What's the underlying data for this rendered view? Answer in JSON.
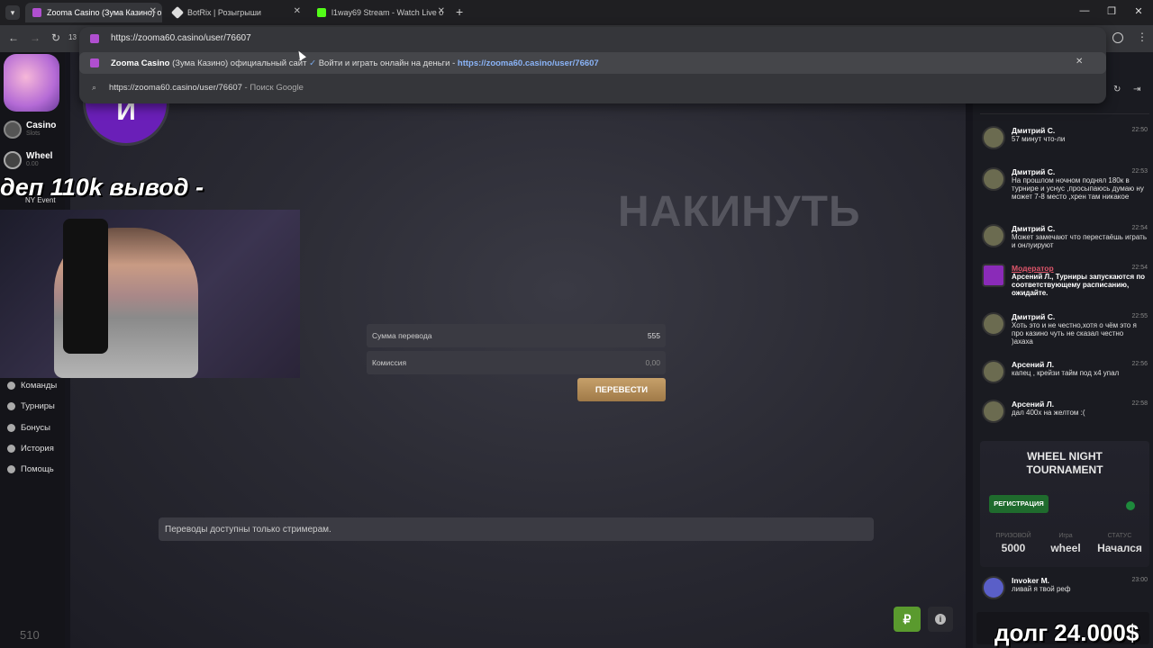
{
  "browser": {
    "tabs": [
      {
        "label": "Zooma Casino (Зума Казино) о",
        "active": true
      },
      {
        "label": "BotRix | Розыгрыши",
        "active": false
      },
      {
        "label": "l1way69 Stream - Watch Live o",
        "active": false
      }
    ],
    "reload_count": "13",
    "url": "https://zooma60.casino/user/76607",
    "suggestions": [
      {
        "site": "Zooma Casino",
        "desc": " (Зума Казино) официальный сайт",
        "rest": " Войти и играть онлайн на деньги - ",
        "url": "https://zooma60.casino/user/76607"
      },
      {
        "site": "",
        "desc": "https://zooma60.casino/user/76607",
        "rest": " - Поиск Google",
        "url": ""
      }
    ]
  },
  "sidebar": {
    "items_top": [
      {
        "label": "Casino",
        "sub": "Slots"
      },
      {
        "label": "Wheel",
        "sub": "0.00"
      }
    ],
    "ny_event": "NY Event",
    "menu": [
      "Команды",
      "Турниры",
      "Бонусы",
      "История",
      "Помощь"
    ],
    "counter": "510"
  },
  "main": {
    "avatar_letter": "И",
    "heading": "НАКИНУТЬ",
    "amount_label": "Сумма перевода",
    "amount_value": "555",
    "fee_label": "Комиссия",
    "fee_value": "0,00",
    "submit_label": "ПЕРЕВЕСТИ",
    "notice": "Переводы доступны только стримерам."
  },
  "chat": {
    "messages": [
      {
        "name": "Дмитрий С.",
        "time": "22:50",
        "text": "57 минут что-ли",
        "mod": false
      },
      {
        "name": "Дмитрий С.",
        "time": "22:53",
        "text": "На прошлом ночном поднял 180к в турнире и уснус ,просыпаюсь думаю ну может 7-8 место ,хрен там никакое",
        "mod": false
      },
      {
        "name": "Дмитрий С.",
        "time": "22:54",
        "text": "Может замечают что перестаёшь играть и онлуируют",
        "mod": false
      },
      {
        "name": "Модератор",
        "time": "22:54",
        "text": "Арсений Л., Турниры запускаются по соответствующему расписанию, ожидайте.",
        "mod": true
      },
      {
        "name": "Дмитрий С.",
        "time": "22:55",
        "text": "Хоть это и не честно,хотя о чём это я про казино чуть не сказал честно )ахаха",
        "mod": false
      },
      {
        "name": "Арсений Л.",
        "time": "22:56",
        "text": "капец , крейзи тайм под х4 упал",
        "mod": false
      },
      {
        "name": "Арсений Л.",
        "time": "22:58",
        "text": "дал 400х на желтом :(",
        "mod": false
      }
    ],
    "tournament": {
      "title": "WHEEL NIGHT TOURNAMENT",
      "register": "РЕГИСТРАЦИЯ",
      "prize_label": "ПРИЗОВОЙ",
      "prize": "5000",
      "game_label": "Игра",
      "game": "wheel",
      "status_label": "СТАТУС",
      "status": "Начался"
    },
    "last": {
      "name": "Invoker M.",
      "time": "23:00",
      "text": "ливай я твой реф"
    }
  },
  "overlay": {
    "top_text": "деп 110k вывод -",
    "debt": "долг 24.000$"
  },
  "colors": {
    "accent_gold": "#c6a06a",
    "register_green": "#1f6b2d",
    "mod_red": "#e0566b"
  }
}
